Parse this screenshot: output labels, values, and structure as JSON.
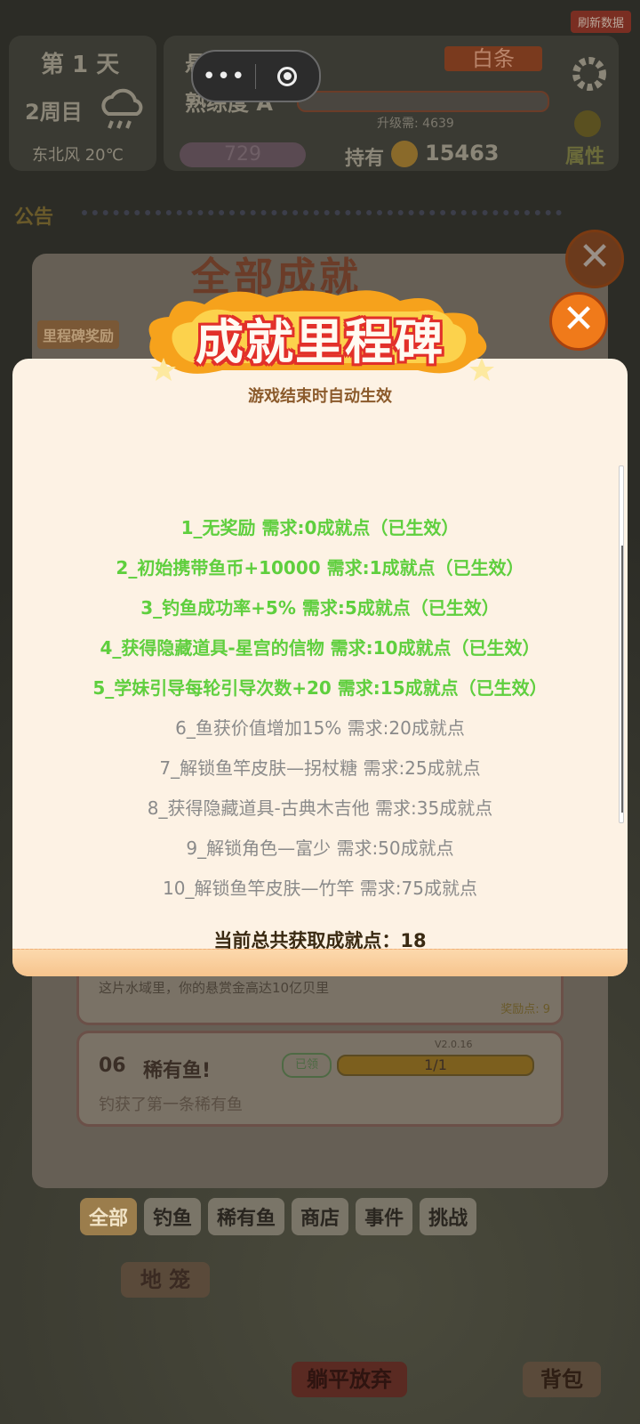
{
  "hud": {
    "refresh_label": "刷新数据",
    "day": "第 1 天",
    "cycle": "2周目",
    "weather": "东北风 20℃",
    "fish_label": "悬赏鱼种",
    "fish_name": "白条",
    "proficiency": "熟练度 A",
    "upgrade_need": "升级需: 4639",
    "hearts": "729",
    "holdings_label": "持有",
    "coins": "15463",
    "attr_label": "属性",
    "notice": "公告"
  },
  "back_panel": {
    "title": "全部成就",
    "milestone_reward_label": "里程碑奖励",
    "card1": {
      "desc": "这片水域里，你的悬赏金高达10亿贝里",
      "reward": "奖励点: 9"
    },
    "card2": {
      "number": "06",
      "title": "稀有鱼!",
      "desc": "钓获了第一条稀有鱼",
      "badge": "已领",
      "progress": "1/1",
      "progress_fraction": 1.0,
      "version": "V2.0.16"
    },
    "tabs": [
      "全部",
      "钓鱼",
      "稀有鱼",
      "商店",
      "事件",
      "挑战"
    ],
    "active_tab": "全部"
  },
  "bottom": {
    "cage_label": "地 笼",
    "give_up_label": "躺平放弃",
    "bag_label": "背包"
  },
  "modal": {
    "title": "成就里程碑",
    "subtitle": "游戏结束时自动生效",
    "milestones": [
      {
        "text": "1_无奖励 需求:0成就点（已生效）",
        "done": true
      },
      {
        "text": "2_初始携带鱼币+10000 需求:1成就点（已生效）",
        "done": true
      },
      {
        "text": "3_钓鱼成功率+5% 需求:5成就点（已生效）",
        "done": true
      },
      {
        "text": "4_获得隐藏道具-星宫的信物 需求:10成就点（已生效）",
        "done": true
      },
      {
        "text": "5_学妹引导每轮引导次数+20 需求:15成就点（已生效）",
        "done": true
      },
      {
        "text": "6_鱼获价值增加15% 需求:20成就点",
        "done": false
      },
      {
        "text": "7_解锁鱼竿皮肤—拐杖糖 需求:25成就点",
        "done": false
      },
      {
        "text": "8_获得隐藏道具-古典木吉他 需求:35成就点",
        "done": false
      },
      {
        "text": "9_解锁角色—富少 需求:50成就点",
        "done": false
      },
      {
        "text": "10_解锁鱼竿皮肤—竹竿 需求:75成就点",
        "done": false
      }
    ],
    "total": "当前总共获取成就点：18"
  },
  "colors": {
    "done": "#5fcf3e",
    "pending": "#8a8a8a",
    "close_button": "#b85a1c",
    "banner_red": "#e2302a"
  }
}
